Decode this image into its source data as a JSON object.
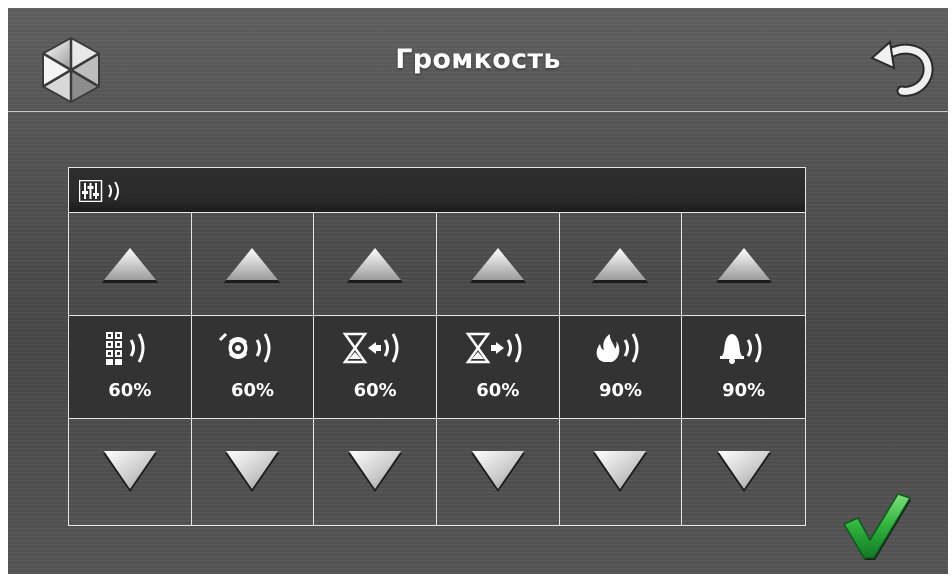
{
  "header": {
    "title": "Громкость",
    "logo_icon": "satel-hexagon-logo-icon",
    "back_icon": "back-arrow-icon"
  },
  "panel": {
    "header_icon": "mixer-sliders-speaker-icon",
    "channels": [
      {
        "icon": "keypad-volume-icon",
        "value": "60%"
      },
      {
        "icon": "siren-volume-icon",
        "value": "60%"
      },
      {
        "icon": "entry-delay-volume-icon",
        "value": "60%"
      },
      {
        "icon": "exit-delay-volume-icon",
        "value": "60%"
      },
      {
        "icon": "fire-alarm-volume-icon",
        "value": "90%"
      },
      {
        "icon": "chime-bell-volume-icon",
        "value": "90%"
      }
    ]
  },
  "footer": {
    "confirm_icon": "green-checkmark-icon"
  },
  "colors": {
    "background": "#4f4f4f",
    "panel_dark": "#333333",
    "border": "#e6e6e6",
    "confirm": "#1e9e3a"
  }
}
